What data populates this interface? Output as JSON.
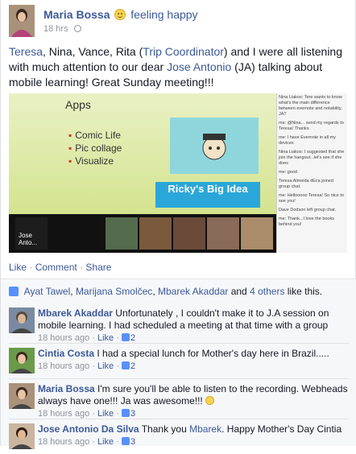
{
  "post": {
    "author": "Maria Bossa",
    "feeling": "feeling happy",
    "time": "18 hrs",
    "text_parts": [
      {
        "t": "Teresa",
        "link": true
      },
      {
        "t": ", Nina, Vance, Rita (",
        "link": false
      },
      {
        "t": "Trip Coordinator",
        "link": true
      },
      {
        "t": ") and I were all listening with much attention to our dear ",
        "link": false
      },
      {
        "t": "Jose Antonio",
        "link": true
      },
      {
        "t": " (JA) talking about mobile learning! Great Sunday meeting!!!",
        "link": false
      }
    ]
  },
  "slide": {
    "title": "Apps",
    "bullets": [
      "Comic Life",
      "Pic collage",
      "Visualize"
    ],
    "sticker_text": "Ricky's Big Idea",
    "strip_label": "Jose Anto..."
  },
  "chat": [
    "Nina Liakos: Tere wants to know what's the main difference between evernote and notability, JA?",
    "me: @Nina... send my regards to Teresa! Thanks",
    "me: I have Evernote in all my devices",
    "Nina Liakos: I suggested that she join the hangout...let's see if she does",
    "me: good",
    "Teresa Almeida dEca joined group chat.",
    "me: Hellooooo Teresa! So nice to see you!",
    "Dave Dodson left group chat.",
    "me: Thank...I love the books behind you!"
  ],
  "actions": {
    "like": "Like",
    "comment": "Comment",
    "share": "Share"
  },
  "likes": {
    "names": [
      "Ayat Tawel",
      "Marijana Smolčec",
      "Mbarek Akaddar"
    ],
    "others": "4 others",
    "suffix": " like this."
  },
  "comments": [
    {
      "name": "Mbarek Akaddar",
      "text": "Unfortunately , I couldn't make it to J.A session on mobile learning. I had scheduled a meeting at that time with a group",
      "time": "18 hours ago",
      "like": "Like",
      "count": "2",
      "smile": false
    },
    {
      "name": "Cintia Costa",
      "text": "I had a special lunch for Mother's day here in Brazil.....",
      "time": "18 hours ago",
      "like": "Like",
      "count": "2",
      "smile": false
    },
    {
      "name": "Maria Bossa",
      "text": "I'm sure you'll be able to listen to the recording. Webheads always have one!!! Ja was awesome!!!",
      "time": "18 hours ago",
      "like": "Like",
      "count": "3",
      "smile": true
    },
    {
      "name": "Jose Antonio Da Silva",
      "text_pre": "Thank you ",
      "text_link": "Mbarek",
      "text_post": ". Happy Mother's Day Cintia",
      "time": "18 hours ago",
      "like": "Like",
      "count": "3",
      "smile": false
    }
  ],
  "colors": {
    "link": "#3b5998",
    "meta": "#90949c",
    "like_blue": "#5890ff"
  }
}
